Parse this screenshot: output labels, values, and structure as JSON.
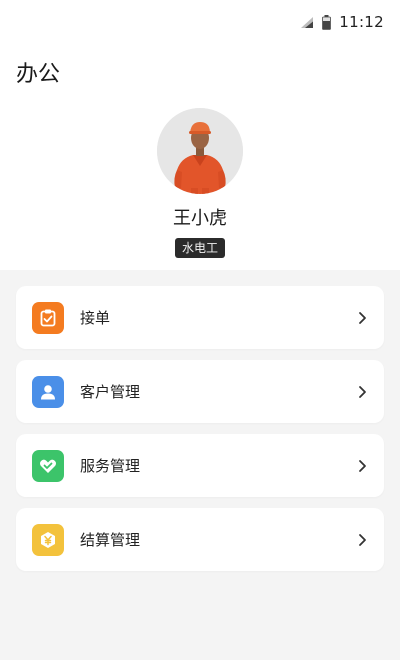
{
  "status_bar": {
    "time": "11:12",
    "icons": [
      "signal-icon",
      "battery-icon"
    ]
  },
  "header": {
    "title": "办公"
  },
  "profile": {
    "name": "王小虎",
    "role": "水电工"
  },
  "menu": {
    "items": [
      {
        "label": "接单",
        "icon": "clipboard-check-icon",
        "color": "#F47B20"
      },
      {
        "label": "客户管理",
        "icon": "person-icon",
        "color": "#4A8FE8"
      },
      {
        "label": "服务管理",
        "icon": "heart-check-icon",
        "color": "#3CC46A"
      },
      {
        "label": "结算管理",
        "icon": "yen-coin-icon",
        "color": "#F3C23C"
      }
    ]
  },
  "colors": {
    "background": "#FFFFFF",
    "menu_background": "#F4F4F4",
    "badge": "#2B2B2B"
  }
}
